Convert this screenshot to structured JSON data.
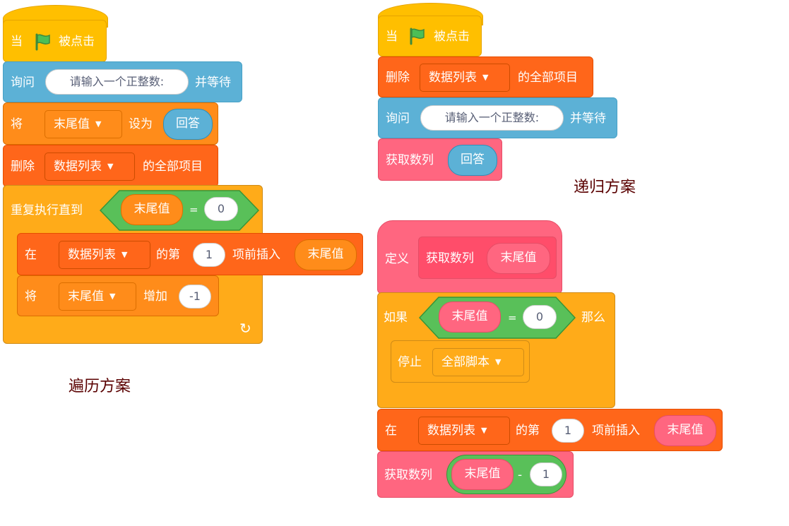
{
  "captions": {
    "traverse": "遍历方案",
    "recursive": "递归方案"
  },
  "left": {
    "when": "当",
    "clicked": "被点击",
    "ask": "询问",
    "ask_prompt": "请输入一个正整数:",
    "and_wait": "并等待",
    "set": "将",
    "var": "末尾值",
    "set_to": "设为",
    "answer": "回答",
    "delete": "删除",
    "list": "数据列表",
    "delete_all": "的全部项目",
    "repeat_until": "重复执行直到",
    "eq": "=",
    "zero": "0",
    "insert_at": "在",
    "insert_nth": "的第",
    "one": "1",
    "insert_before": "项前插入",
    "change": "将",
    "change_by": "增加",
    "minus_one": "-1",
    "loop_arrow": "↻"
  },
  "right": {
    "when": "当",
    "clicked": "被点击",
    "delete": "删除",
    "list": "数据列表",
    "delete_all": "的全部项目",
    "ask": "询问",
    "ask_prompt": "请输入一个正整数:",
    "and_wait": "并等待",
    "get_list": "获取数列",
    "answer": "回答",
    "define": "定义",
    "param": "末尾值",
    "if": "如果",
    "eq": "=",
    "zero": "0",
    "then": "那么",
    "stop": "停止",
    "stop_opt": "全部脚本",
    "insert_at": "在",
    "insert_nth": "的第",
    "one": "1",
    "insert_before": "项前插入",
    "minus": "-"
  }
}
